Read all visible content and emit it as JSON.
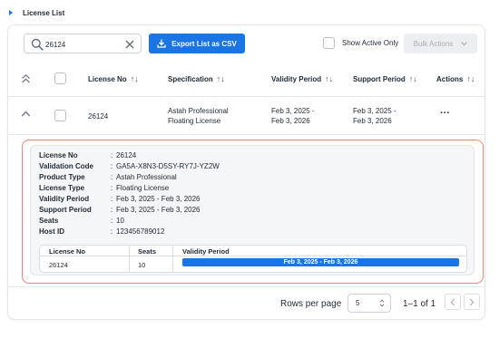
{
  "section": {
    "title": "License List"
  },
  "toolbar": {
    "search_value": "26124",
    "export_label": "Export List as CSV",
    "show_active_label": "Show Active Only",
    "bulk_actions_label": "Bulk Actions"
  },
  "table": {
    "headers": {
      "license_no": "License No",
      "specification": "Specification",
      "validity_period": "Validity Period",
      "support_period": "Support Period",
      "actions": "Actions"
    },
    "sort_glyph": "↑↓",
    "rows": [
      {
        "license_no": "26124",
        "specification_line1": "Astah Professional",
        "specification_line2": "Floating License",
        "validity_line1": "Feb 3, 2025 -",
        "validity_line2": "Feb 3, 2026",
        "support_line1": "Feb 3, 2025 -",
        "support_line2": "Feb 3, 2026",
        "actions": "···"
      }
    ]
  },
  "detail": {
    "fields": [
      {
        "label": "License No",
        "value": "26124"
      },
      {
        "label": "Validation Code",
        "value": "GA5A-X8N3-D5SY-RY7J-YZ2W"
      },
      {
        "label": "Product Type",
        "value": "Astah Professional"
      },
      {
        "label": "License Type",
        "value": "Floating License"
      },
      {
        "label": "Validity Period",
        "value": "Feb 3, 2025 - Feb 3, 2026"
      },
      {
        "label": "Support Period",
        "value": "Feb 3, 2025 - Feb 3, 2026"
      },
      {
        "label": "Seats",
        "value": "10"
      },
      {
        "label": "Host ID",
        "value": "123456789012"
      }
    ],
    "separator": ":",
    "subtable": {
      "headers": {
        "license_no": "License No",
        "seats": "Seats",
        "validity_period": "Validity Period"
      },
      "row": {
        "license_no": "26124",
        "seats": "10",
        "validity_period": "Feb 3, 2025 - Feb 3, 2026"
      }
    }
  },
  "pagination": {
    "rows_per_page_label": "Rows per page",
    "rows_per_page_value": "5",
    "range_text": "1–1 of 1"
  },
  "colors": {
    "accent": "#1b74e4",
    "detail_border": "#e8847a"
  }
}
